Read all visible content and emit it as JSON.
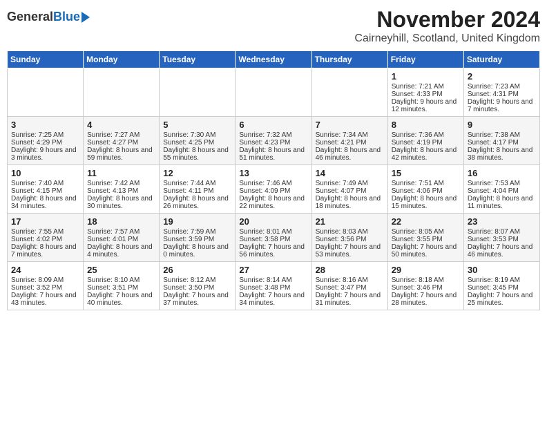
{
  "logo": {
    "general": "General",
    "blue": "Blue"
  },
  "title": "November 2024",
  "location": "Cairneyhill, Scotland, United Kingdom",
  "days_header": [
    "Sunday",
    "Monday",
    "Tuesday",
    "Wednesday",
    "Thursday",
    "Friday",
    "Saturday"
  ],
  "weeks": [
    [
      {
        "day": "",
        "info": ""
      },
      {
        "day": "",
        "info": ""
      },
      {
        "day": "",
        "info": ""
      },
      {
        "day": "",
        "info": ""
      },
      {
        "day": "",
        "info": ""
      },
      {
        "day": "1",
        "info": "Sunrise: 7:21 AM\nSunset: 4:33 PM\nDaylight: 9 hours and 12 minutes."
      },
      {
        "day": "2",
        "info": "Sunrise: 7:23 AM\nSunset: 4:31 PM\nDaylight: 9 hours and 7 minutes."
      }
    ],
    [
      {
        "day": "3",
        "info": "Sunrise: 7:25 AM\nSunset: 4:29 PM\nDaylight: 9 hours and 3 minutes."
      },
      {
        "day": "4",
        "info": "Sunrise: 7:27 AM\nSunset: 4:27 PM\nDaylight: 8 hours and 59 minutes."
      },
      {
        "day": "5",
        "info": "Sunrise: 7:30 AM\nSunset: 4:25 PM\nDaylight: 8 hours and 55 minutes."
      },
      {
        "day": "6",
        "info": "Sunrise: 7:32 AM\nSunset: 4:23 PM\nDaylight: 8 hours and 51 minutes."
      },
      {
        "day": "7",
        "info": "Sunrise: 7:34 AM\nSunset: 4:21 PM\nDaylight: 8 hours and 46 minutes."
      },
      {
        "day": "8",
        "info": "Sunrise: 7:36 AM\nSunset: 4:19 PM\nDaylight: 8 hours and 42 minutes."
      },
      {
        "day": "9",
        "info": "Sunrise: 7:38 AM\nSunset: 4:17 PM\nDaylight: 8 hours and 38 minutes."
      }
    ],
    [
      {
        "day": "10",
        "info": "Sunrise: 7:40 AM\nSunset: 4:15 PM\nDaylight: 8 hours and 34 minutes."
      },
      {
        "day": "11",
        "info": "Sunrise: 7:42 AM\nSunset: 4:13 PM\nDaylight: 8 hours and 30 minutes."
      },
      {
        "day": "12",
        "info": "Sunrise: 7:44 AM\nSunset: 4:11 PM\nDaylight: 8 hours and 26 minutes."
      },
      {
        "day": "13",
        "info": "Sunrise: 7:46 AM\nSunset: 4:09 PM\nDaylight: 8 hours and 22 minutes."
      },
      {
        "day": "14",
        "info": "Sunrise: 7:49 AM\nSunset: 4:07 PM\nDaylight: 8 hours and 18 minutes."
      },
      {
        "day": "15",
        "info": "Sunrise: 7:51 AM\nSunset: 4:06 PM\nDaylight: 8 hours and 15 minutes."
      },
      {
        "day": "16",
        "info": "Sunrise: 7:53 AM\nSunset: 4:04 PM\nDaylight: 8 hours and 11 minutes."
      }
    ],
    [
      {
        "day": "17",
        "info": "Sunrise: 7:55 AM\nSunset: 4:02 PM\nDaylight: 8 hours and 7 minutes."
      },
      {
        "day": "18",
        "info": "Sunrise: 7:57 AM\nSunset: 4:01 PM\nDaylight: 8 hours and 4 minutes."
      },
      {
        "day": "19",
        "info": "Sunrise: 7:59 AM\nSunset: 3:59 PM\nDaylight: 8 hours and 0 minutes."
      },
      {
        "day": "20",
        "info": "Sunrise: 8:01 AM\nSunset: 3:58 PM\nDaylight: 7 hours and 56 minutes."
      },
      {
        "day": "21",
        "info": "Sunrise: 8:03 AM\nSunset: 3:56 PM\nDaylight: 7 hours and 53 minutes."
      },
      {
        "day": "22",
        "info": "Sunrise: 8:05 AM\nSunset: 3:55 PM\nDaylight: 7 hours and 50 minutes."
      },
      {
        "day": "23",
        "info": "Sunrise: 8:07 AM\nSunset: 3:53 PM\nDaylight: 7 hours and 46 minutes."
      }
    ],
    [
      {
        "day": "24",
        "info": "Sunrise: 8:09 AM\nSunset: 3:52 PM\nDaylight: 7 hours and 43 minutes."
      },
      {
        "day": "25",
        "info": "Sunrise: 8:10 AM\nSunset: 3:51 PM\nDaylight: 7 hours and 40 minutes."
      },
      {
        "day": "26",
        "info": "Sunrise: 8:12 AM\nSunset: 3:50 PM\nDaylight: 7 hours and 37 minutes."
      },
      {
        "day": "27",
        "info": "Sunrise: 8:14 AM\nSunset: 3:48 PM\nDaylight: 7 hours and 34 minutes."
      },
      {
        "day": "28",
        "info": "Sunrise: 8:16 AM\nSunset: 3:47 PM\nDaylight: 7 hours and 31 minutes."
      },
      {
        "day": "29",
        "info": "Sunrise: 8:18 AM\nSunset: 3:46 PM\nDaylight: 7 hours and 28 minutes."
      },
      {
        "day": "30",
        "info": "Sunrise: 8:19 AM\nSunset: 3:45 PM\nDaylight: 7 hours and 25 minutes."
      }
    ]
  ]
}
